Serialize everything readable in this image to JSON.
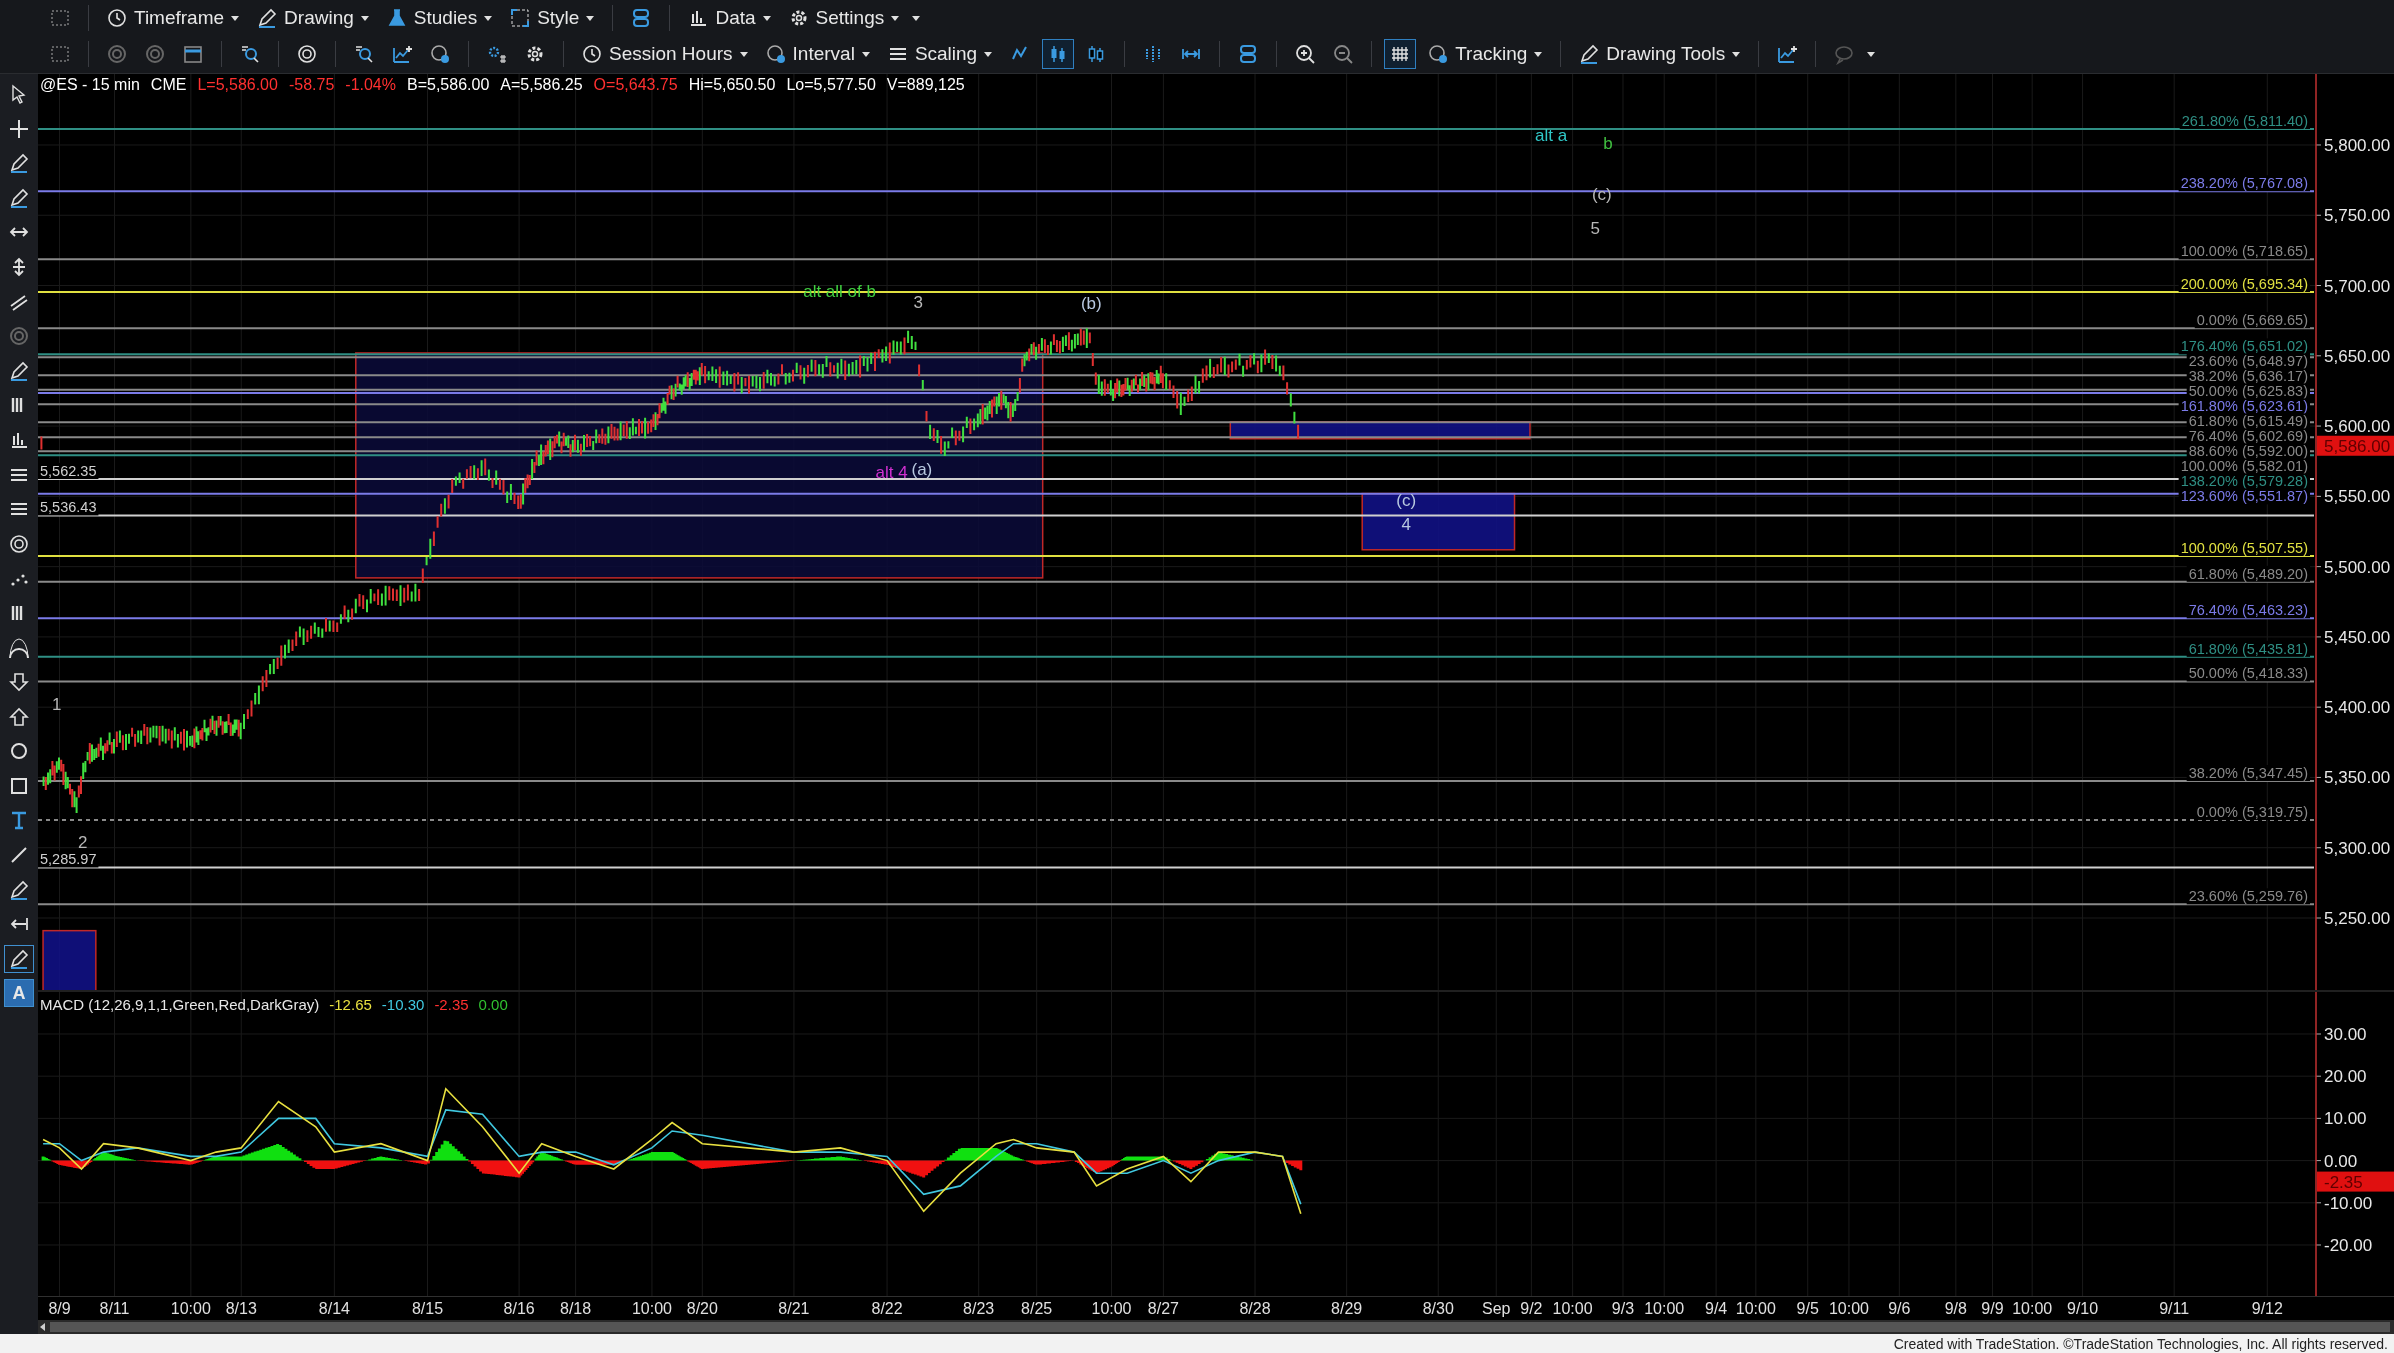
{
  "toolbar": {
    "row1": [
      {
        "label": "Timeframe"
      },
      {
        "label": "Drawing"
      },
      {
        "label": "Studies"
      },
      {
        "label": "Style"
      },
      {
        "label": "Data"
      },
      {
        "label": "Settings"
      }
    ],
    "row2": [
      {
        "label": "Session Hours"
      },
      {
        "label": "Interval"
      },
      {
        "label": "Scaling"
      },
      {
        "label": "Tracking"
      },
      {
        "label": "Drawing Tools"
      }
    ],
    "chart_style_buttons": [
      {
        "selected": false
      },
      {
        "selected": true
      },
      {
        "selected": false
      }
    ],
    "grid_toggle": {
      "selected": true
    }
  },
  "tools": [
    {
      "selected": false
    },
    {
      "selected": false
    },
    {
      "selected": false
    },
    {
      "selected": false
    },
    {
      "selected": false
    },
    {
      "selected": false
    },
    {
      "selected": false
    },
    {
      "selected": false
    },
    {
      "selected": false
    },
    {
      "selected": false
    },
    {
      "selected": false
    },
    {
      "selected": false
    },
    {
      "selected": false
    },
    {
      "selected": false
    },
    {
      "selected": false
    },
    {
      "selected": false
    },
    {
      "selected": false
    },
    {
      "selected": false
    },
    {
      "selected": false
    },
    {
      "selected": false
    },
    {
      "selected": false
    },
    {
      "selected": false
    },
    {
      "selected": false
    },
    {
      "selected": false
    },
    {
      "selected": false
    },
    {
      "selected": true
    },
    {
      "label": "A",
      "selected": true
    }
  ],
  "price_pane": {
    "quote": [
      {
        "text": "@ES - 15 min",
        "color": "#ffffff"
      },
      {
        "text": "CME",
        "color": "#ffffff"
      },
      {
        "text": "L=5,586.00",
        "color": "#ff3030"
      },
      {
        "text": "-58.75",
        "color": "#ff3030"
      },
      {
        "text": "-1.04%",
        "color": "#ff3030"
      },
      {
        "text": "B=5,586.00",
        "color": "#ffffff"
      },
      {
        "text": "A=5,586.25",
        "color": "#ffffff"
      },
      {
        "text": "O=5,643.75",
        "color": "#ff3030"
      },
      {
        "text": "Hi=5,650.50",
        "color": "#ffffff"
      },
      {
        "text": "Lo=5,577.50",
        "color": "#ffffff"
      },
      {
        "text": "V=889,125",
        "color": "#ffffff"
      }
    ],
    "axis_labels": [
      "5,800.00",
      "5,750.00",
      "5,700.00",
      "5,650.00",
      "5,600.00",
      "5,550.00",
      "5,500.00",
      "5,450.00",
      "5,400.00",
      "5,350.00",
      "5,300.00",
      "5,250.00"
    ],
    "last_price": "5,586.00",
    "levels": [
      {
        "label": "261.80% (5,811.40)",
        "color": "#2f8f84",
        "dashed": false
      },
      {
        "label": "238.20% (5,767.08)",
        "color": "#7b7be8",
        "dashed": false
      },
      {
        "label": "100.00% (5,718.65)",
        "color": "#8a8a8a",
        "dashed": false
      },
      {
        "label": "200.00% (5,695.34)",
        "color": "#e0e040",
        "dashed": false
      },
      {
        "label": "0.00% (5,669.65)",
        "color": "#8a8a8a",
        "dashed": false
      },
      {
        "label": "176.40% (5,651.02)",
        "color": "#2f8f84",
        "dashed": false
      },
      {
        "label": "23.60% (5,648.97)",
        "color": "#8a8a8a",
        "dashed": false
      },
      {
        "label": "38.20% (5,636.17)",
        "color": "#8a8a8a",
        "dashed": false
      },
      {
        "label": "50.00% (5,625.83)",
        "color": "#8a8a8a",
        "dashed": false
      },
      {
        "label": "161.80% (5,623.61)",
        "color": "#7b7be8",
        "dashed": false
      },
      {
        "label": "61.80% (5,615.49)",
        "color": "#8a8a8a",
        "dashed": false
      },
      {
        "label": "76.40% (5,602.69)",
        "color": "#8a8a8a",
        "dashed": false
      },
      {
        "label": "88.60% (5,592.00)",
        "color": "#8a8a8a",
        "dashed": false
      },
      {
        "label": "100.00% (5,582.01)",
        "color": "#8a8a8a",
        "dashed": false
      },
      {
        "label": "138.20% (5,579.28)",
        "color": "#2f8f84",
        "dashed": false
      },
      {
        "label": "5,562.35",
        "color": "#d0d0d0",
        "dashed": false
      },
      {
        "label": "123.60% (5,551.87)",
        "color": "#7b7be8",
        "dashed": false
      },
      {
        "label": "5,536.43",
        "color": "#d0d0d0",
        "dashed": false
      },
      {
        "label": "100.00% (5,507.55)",
        "color": "#e0e040",
        "dashed": false
      },
      {
        "label": "61.80% (5,489.20)",
        "color": "#8a8a8a",
        "dashed": false
      },
      {
        "label": "76.40% (5,463.23)",
        "color": "#7b7be8",
        "dashed": false
      },
      {
        "label": "61.80% (5,435.81)",
        "color": "#2f8f84",
        "dashed": false
      },
      {
        "label": "50.00% (5,418.33)",
        "color": "#8a8a8a",
        "dashed": false
      },
      {
        "label": "38.20% (5,347.45)",
        "color": "#8a8a8a",
        "dashed": false
      },
      {
        "label": "0.00% (5,319.75)",
        "color": "#8a8a8a",
        "dashed": true
      },
      {
        "label": "5,285.97",
        "color": "#d0d0d0",
        "dashed": false
      },
      {
        "label": "23.60% (5,259.76)",
        "color": "#8a8a8a",
        "dashed": false
      }
    ],
    "wave_labels": [
      {
        "text": "alt a",
        "color": "#30c8c8"
      },
      {
        "text": "b",
        "color": "#40c040"
      },
      {
        "text": "(c)",
        "color": "#b8b8b8"
      },
      {
        "text": "5",
        "color": "#b8b8b8"
      },
      {
        "text": "alt all of b",
        "color": "#40d040"
      },
      {
        "text": "3",
        "color": "#b8b8b8"
      },
      {
        "text": "(b)",
        "color": "#b8c8e0"
      },
      {
        "text": "alt 4",
        "color": "#d030d0"
      },
      {
        "text": "(a)",
        "color": "#b8c8e0"
      },
      {
        "text": "(c)",
        "color": "#b8c8e0"
      },
      {
        "text": "4",
        "color": "#b8c8e0"
      },
      {
        "text": "1",
        "color": "#b8b8b8"
      },
      {
        "text": "2",
        "color": "#b8b8b8"
      }
    ]
  },
  "macd_pane": {
    "title": "MACD (12,26,9,1,1,Green,Red,DarkGray)",
    "readings": [
      {
        "text": "-12.65",
        "color": "#e8e040"
      },
      {
        "text": "-10.30",
        "color": "#40c8e0"
      },
      {
        "text": "-2.35",
        "color": "#ff3030"
      },
      {
        "text": "0.00",
        "color": "#30c030"
      }
    ],
    "axis_labels": [
      "30.00",
      "20.00",
      "10.00",
      "0.00",
      "-10.00",
      "-20.00"
    ],
    "last_value": "-2.35"
  },
  "time_axis": [
    "8/9",
    "8/11",
    "10:00",
    "8/13",
    "8/14",
    "8/15",
    "8/16",
    "8/18",
    "10:00",
    "8/20",
    "8/21",
    "8/22",
    "8/23",
    "8/25",
    "10:00",
    "8/27",
    "8/28",
    "8/29",
    "8/30",
    "Sep",
    "9/2",
    "10:00",
    "9/3",
    "10:00",
    "9/4",
    "10:00",
    "9/5",
    "10:00",
    "9/6",
    "9/8",
    "9/9",
    "10:00",
    "9/10",
    "9/11",
    "9/12"
  ],
  "footer": "Created with TradeStation. ©TradeStation Technologies, Inc. All rights reserved."
}
